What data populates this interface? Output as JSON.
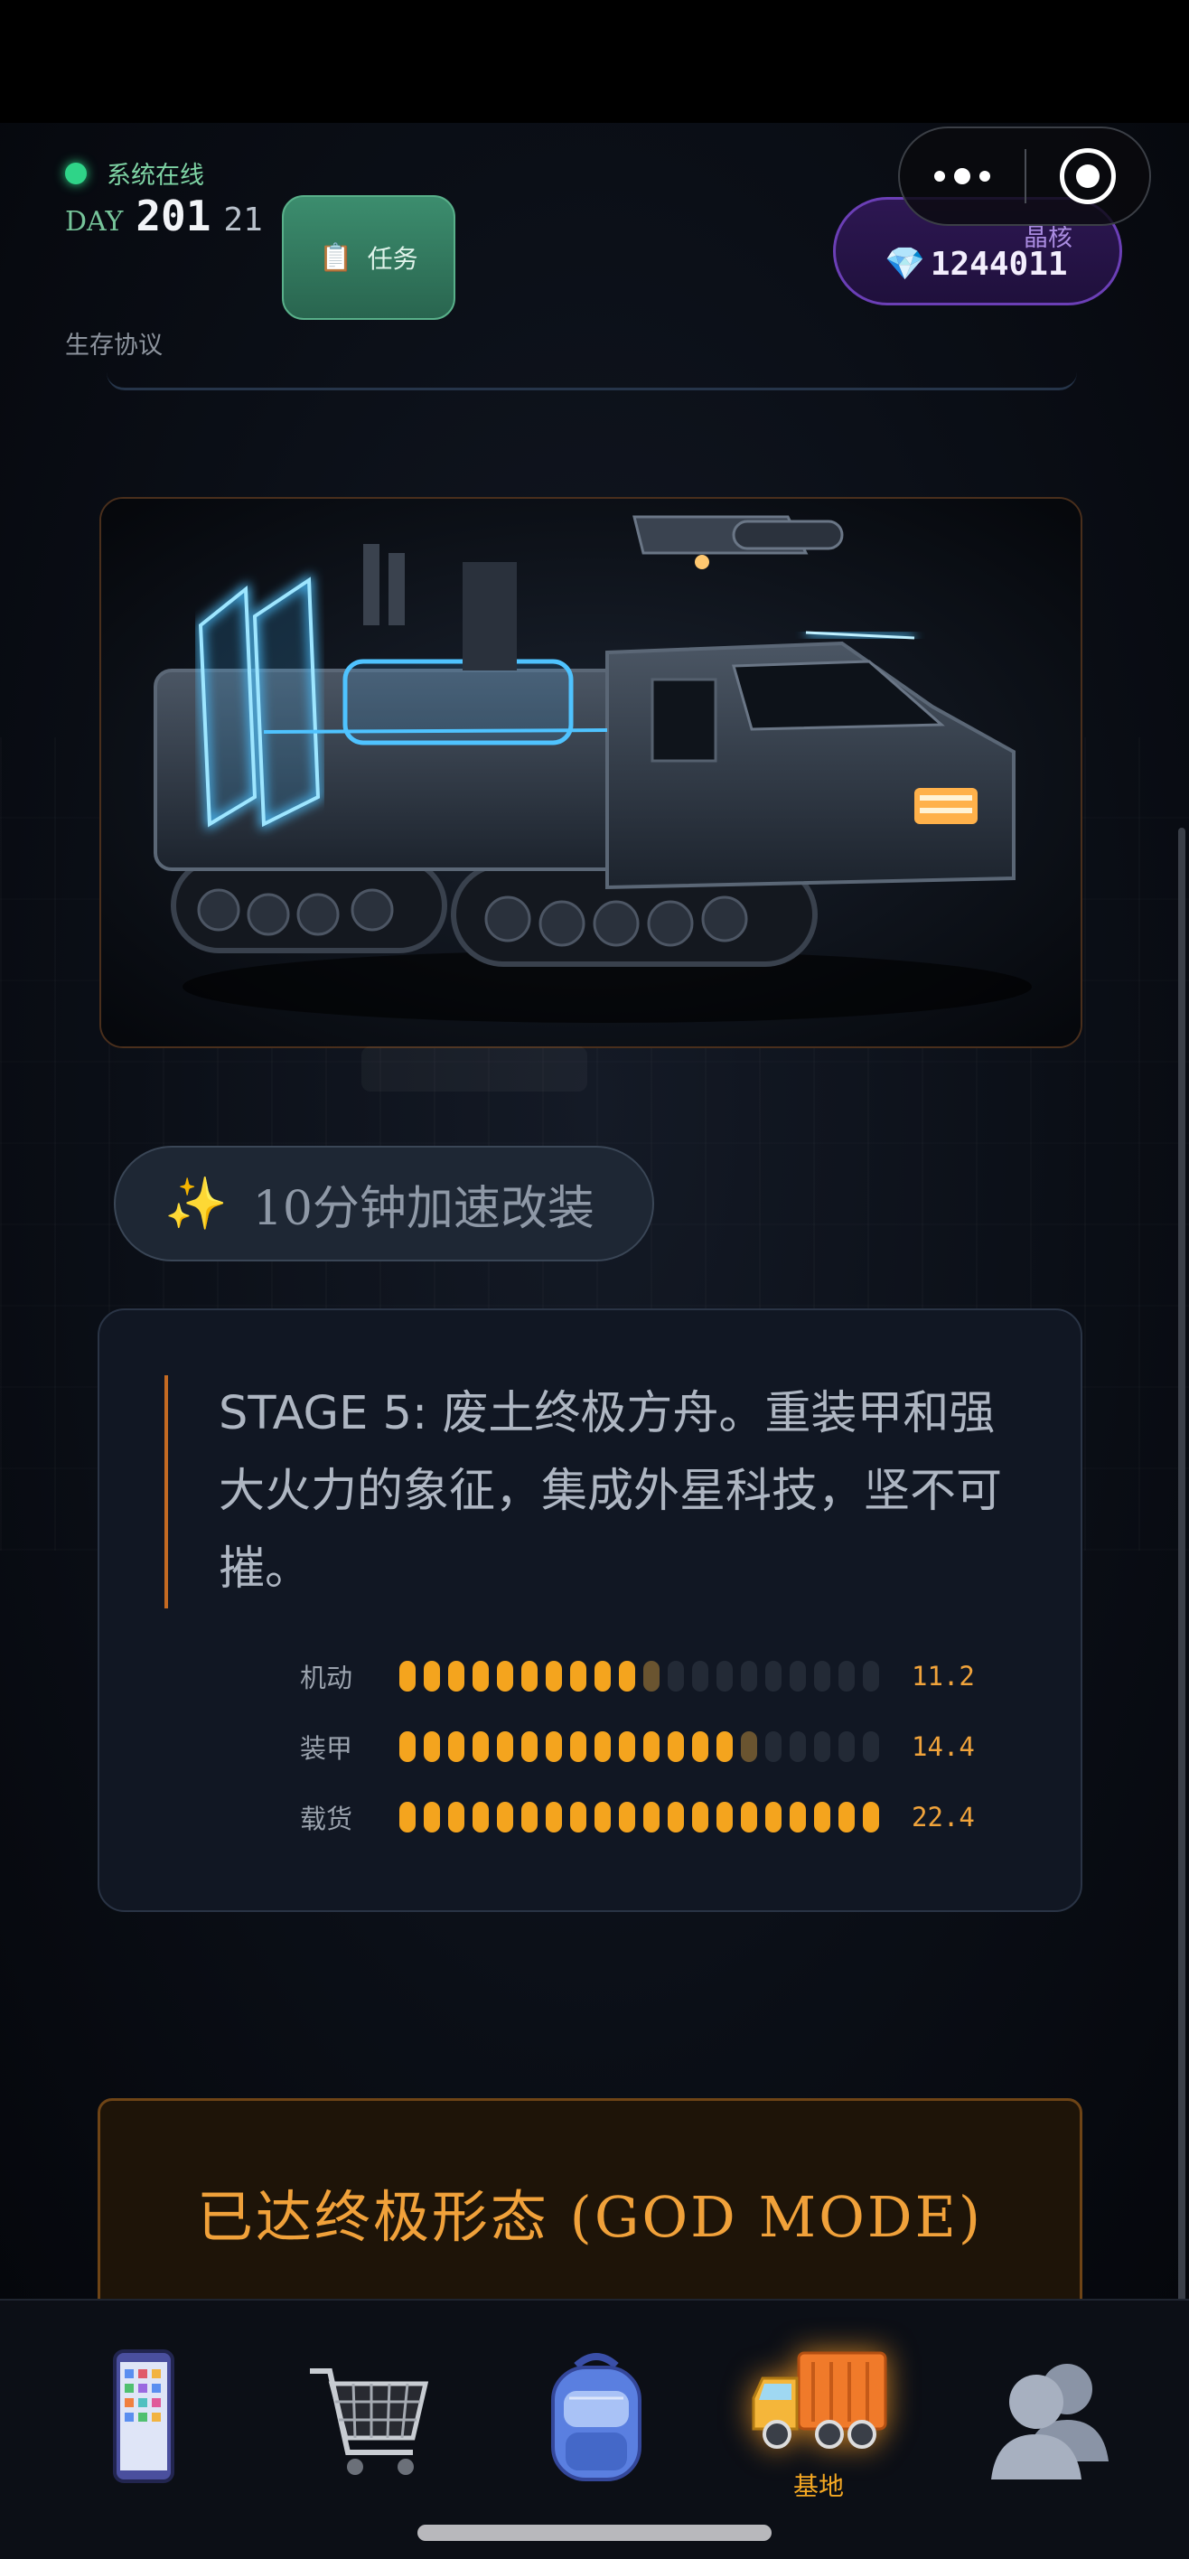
{
  "header": {
    "status_text": "系统在线",
    "day_label": "DAY",
    "day_number": "201",
    "day_hour": "21",
    "protocol_label": "生存协议",
    "mission_button": {
      "icon": "clipboard-icon",
      "label": "任务"
    },
    "crystal": {
      "label": "晶核",
      "icon": "gem-icon",
      "value": "1244011"
    },
    "colors": {
      "online": "#2fd488",
      "mission": "#3c8d6e",
      "crystal": "#6b3fb6"
    }
  },
  "speed_up": {
    "icon": "sparkles-icon",
    "label": "10分钟加速改装"
  },
  "vehicle": {
    "description": "STAGE 5: 废土终极方舟。重装甲和强大火力的象征，集成外星科技，坚不可摧。",
    "stats": [
      {
        "name": "机动",
        "value": "11.2",
        "level": 0.5
      },
      {
        "name": "装甲",
        "value": "14.4",
        "level": 0.7
      },
      {
        "name": "载货",
        "value": "22.4",
        "level": 1.0
      }
    ],
    "accent": "#f4a41e"
  },
  "god_mode": {
    "label": "已达终极形态 (GOD MODE)"
  },
  "tabbar": {
    "tabs": [
      {
        "icon": "phone-icon",
        "label": ""
      },
      {
        "icon": "cart-icon",
        "label": ""
      },
      {
        "icon": "backpack-icon",
        "label": ""
      },
      {
        "icon": "truck-icon",
        "label": "基地",
        "active": true
      },
      {
        "icon": "users-icon",
        "label": ""
      }
    ]
  }
}
